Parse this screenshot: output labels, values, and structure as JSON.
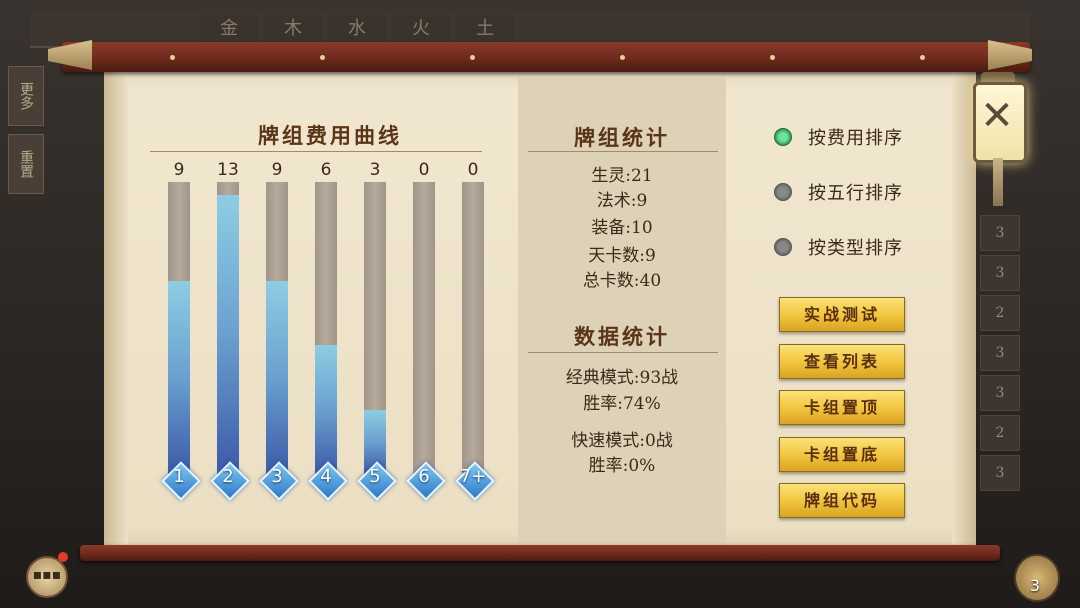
{
  "background": {
    "tabs": [
      "金",
      "木",
      "水",
      "火",
      "土"
    ],
    "left_buttons": [
      "更多",
      "重置"
    ],
    "right_column_values": [
      "3",
      "3",
      "2",
      "3",
      "3",
      "2",
      "3"
    ]
  },
  "cost_curve": {
    "title": "牌组费用曲线"
  },
  "chart_data": {
    "type": "bar",
    "title": "牌组费用曲线",
    "categories": [
      "1",
      "2",
      "3",
      "4",
      "5",
      "6",
      "7+"
    ],
    "values": [
      9,
      13,
      9,
      6,
      3,
      0,
      0
    ],
    "ylim": [
      0,
      13.6
    ],
    "grid": false,
    "legend": "none"
  },
  "deck_stats": {
    "title": "牌组统计",
    "lines": [
      "生灵:21",
      "法术:9",
      "装备:10",
      "天卡数:9",
      "总卡数:40"
    ]
  },
  "data_stats": {
    "title": "数据统计",
    "classic_mode": "经典模式:93战",
    "classic_winrate": "胜率:74%",
    "quick_mode": "快速模式:0战",
    "quick_winrate": "胜率:0%"
  },
  "sort_options": [
    {
      "label": "按费用排序",
      "selected": true
    },
    {
      "label": "按五行排序",
      "selected": false
    },
    {
      "label": "按类型排序",
      "selected": false
    }
  ],
  "buttons": {
    "combat_test": "实战测试",
    "view_list": "查看列表",
    "deck_top": "卡组置顶",
    "deck_bottom": "卡组置底",
    "deck_code": "牌组代码"
  },
  "close_glyph": "✕",
  "chat_glyph": "▪▪▪",
  "deck_count": "3",
  "colors": {
    "bar_fill_top": "#8dcde3",
    "bar_fill_bottom": "#3c5aa8",
    "gold_button": "#f2c640",
    "radio_selected": "#2f9a5a",
    "scroll_rod": "#6e2a1c"
  }
}
